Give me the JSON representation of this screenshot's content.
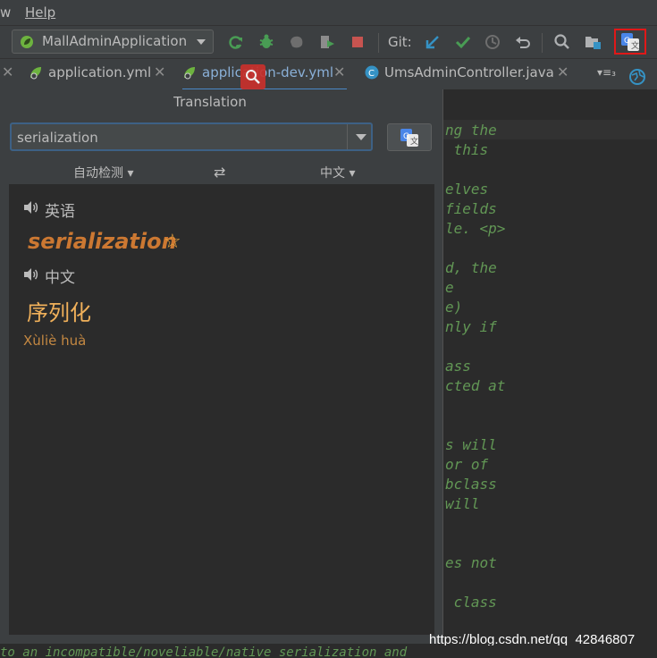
{
  "menubar": {
    "view_fragment": "w",
    "help": "Help"
  },
  "toolbar": {
    "run_config": "MallAdminApplication",
    "git_label": "Git:",
    "icons": [
      "rerun-icon",
      "debug-icon",
      "coverage-icon",
      "profile-icon",
      "stop-icon",
      "git-update-icon",
      "git-commit-icon",
      "history-icon",
      "rollback-icon",
      "search-icon",
      "project-structure-icon",
      "translate-icon"
    ]
  },
  "tabs": [
    {
      "label": "application.yml",
      "icon": "yaml-spring-icon"
    },
    {
      "label": "application-dev.yml",
      "icon": "yaml-spring-icon",
      "active": true
    },
    {
      "label": "UmsAdminController.java",
      "icon": "java-class-icon"
    }
  ],
  "tabs_overflow": "▾≡₃",
  "code_lines": [
    "ng the",
    " this",
    "",
    "elves",
    "fields",
    "le. <p>",
    "",
    "d, the",
    "e",
    "e)",
    "nly if",
    "",
    "ass",
    "cted at",
    "",
    "",
    "s will",
    "or of",
    "bclass",
    "will",
    "",
    "",
    "es not",
    "",
    " class"
  ],
  "popup": {
    "title": "Translation",
    "query": "serialization",
    "source_lang": "自动检测",
    "target_lang": "中文",
    "swap_icon": "⇄",
    "source_section_lang": "英语",
    "source_word": "serialization",
    "star_icon": "☆",
    "target_section_lang": "中文",
    "translation": "序列化",
    "pinyin": "Xùliè huà"
  },
  "watermark": "https://blog.csdn.net/qq_42846807",
  "bottom_code": "to an incompatible/noveliable/native serialization and"
}
